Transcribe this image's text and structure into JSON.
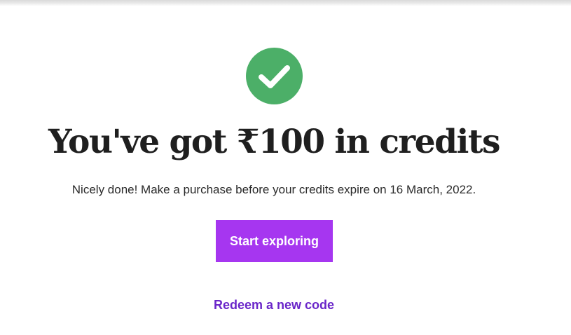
{
  "success": {
    "icon": "check-circle-icon",
    "icon_color": "#4caf68",
    "headline": "You've got ₹100 in credits",
    "message": "Nicely done! Make a purchase before your credits expire on 16 March, 2022."
  },
  "actions": {
    "primary_label": "Start exploring",
    "primary_color": "#a636f0",
    "secondary_label": "Redeem a new code",
    "secondary_color": "#6a26c9"
  }
}
